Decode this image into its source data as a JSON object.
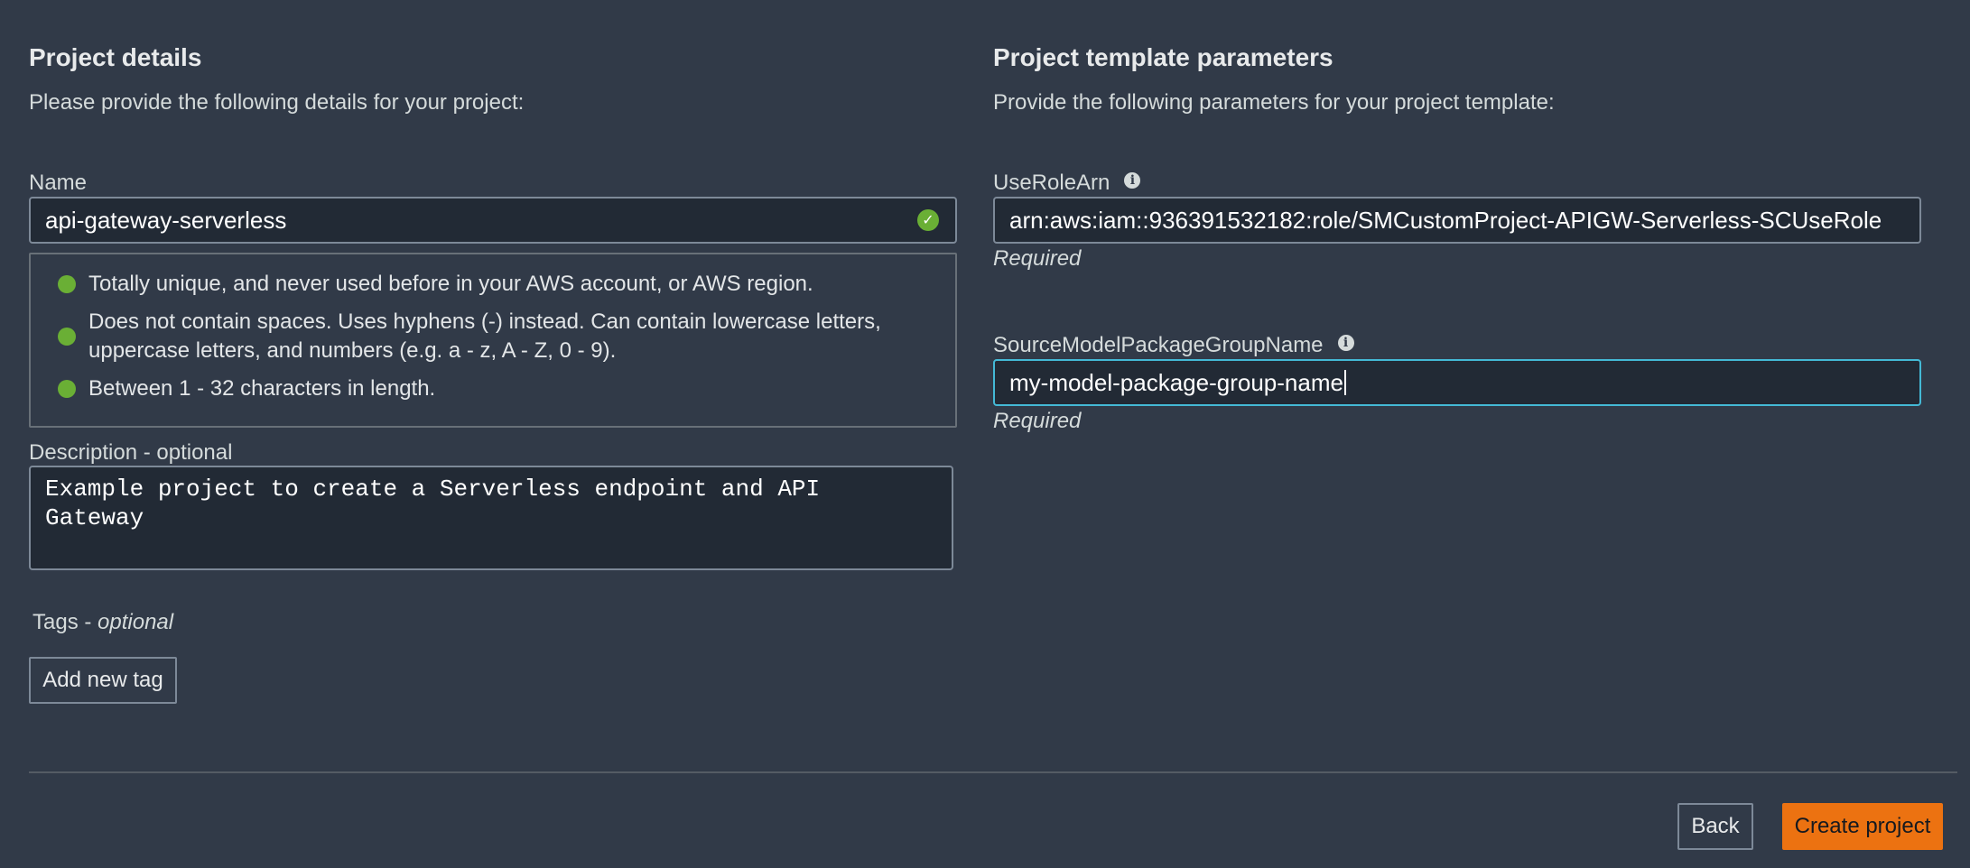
{
  "project_details": {
    "title": "Project details",
    "subtitle": "Please provide the following details for your project:",
    "name": {
      "label": "Name",
      "value": "api-gateway-serverless",
      "valid_icon": "check-circle-icon",
      "rules": [
        {
          "text": "Totally unique, and never used before in your AWS account, or AWS region."
        },
        {
          "line1": "Does not contain spaces. Uses hyphens (-) instead. Can contain lowercase letters,",
          "line2": "uppercase letters, and numbers (e.g. a - z, A - Z, 0 - 9)."
        },
        {
          "text": "Between 1 - 32 characters in length."
        }
      ]
    },
    "description": {
      "label": "Description - optional",
      "value": "Example project to create a Serverless endpoint and API\nGateway"
    },
    "tags": {
      "label": "Tags - ",
      "label_optional": "optional",
      "add_button": "Add new tag"
    }
  },
  "template_parameters": {
    "title": "Project template parameters",
    "subtitle": "Provide the following parameters for your project template:",
    "params": [
      {
        "label": "UseRoleArn",
        "value": "arn:aws:iam::936391532182:role/SMCustomProject-APIGW-Serverless-SCUseRole",
        "hint": "Required"
      },
      {
        "label": "SourceModelPackageGroupName",
        "value": "my-model-package-group-name",
        "hint": "Required"
      }
    ]
  },
  "footer": {
    "back_button": "Back",
    "create_button": "Create project"
  },
  "colors": {
    "background": "#313a48",
    "input_bg": "#222a35",
    "accent_orange": "#ec7211",
    "focus_blue": "#44b9d6",
    "success_green": "#6aaf35"
  }
}
